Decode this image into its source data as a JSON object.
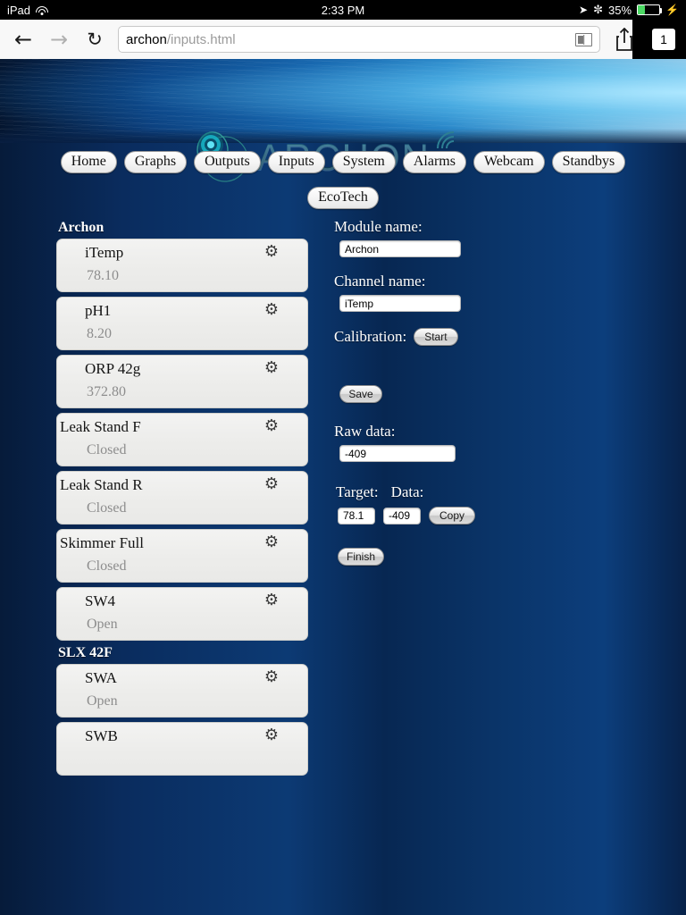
{
  "statusbar": {
    "carrier": "iPad",
    "wifi_icon": "wifi-icon",
    "time": "2:33 PM",
    "location_icon": "location-arrow-icon",
    "bluetooth_icon": "bluetooth-icon",
    "battery_percent": "35%",
    "battery_level": 35,
    "charging_icon": "lightning-bolt-icon"
  },
  "browser": {
    "back_icon": "back-arrow-icon",
    "forward_icon": "forward-arrow-icon",
    "reload_icon": "reload-icon",
    "url_host": "archon",
    "url_path": "/inputs.html",
    "url_full": "archon/inputs.html",
    "reader_icon": "reader-view-icon",
    "share_icon": "share-icon",
    "bookmark_icon": "star-icon",
    "tab_count": "1"
  },
  "header": {
    "logo_text": "ARCHON",
    "logo_mark_icon": "archon-circle-logo-icon",
    "logo_wifi_icon": "wifi-signal-icon"
  },
  "nav": {
    "row1": [
      {
        "label": "Home"
      },
      {
        "label": "Graphs"
      },
      {
        "label": "Outputs"
      },
      {
        "label": "Inputs"
      },
      {
        "label": "System"
      },
      {
        "label": "Alarms"
      },
      {
        "label": "Webcam"
      },
      {
        "label": "Standbys"
      }
    ],
    "row2": [
      {
        "label": "EcoTech"
      }
    ]
  },
  "channel_list": {
    "groups": [
      {
        "title": "Archon",
        "items": [
          {
            "name": "iTemp",
            "value": "78.10",
            "flush": false,
            "gear_icon": "gear-icon"
          },
          {
            "name": "pH1",
            "value": "8.20",
            "flush": false,
            "gear_icon": "gear-icon"
          },
          {
            "name": "ORP 42g",
            "value": "372.80",
            "flush": false,
            "gear_icon": "gear-icon"
          },
          {
            "name": "Leak Stand F",
            "value": "Closed",
            "flush": true,
            "gear_icon": "gear-icon"
          },
          {
            "name": "Leak Stand R",
            "value": "Closed",
            "flush": true,
            "gear_icon": "gear-icon"
          },
          {
            "name": "Skimmer Full",
            "value": "Closed",
            "flush": true,
            "gear_icon": "gear-icon"
          },
          {
            "name": "SW4",
            "value": "Open",
            "flush": false,
            "gear_icon": "gear-icon"
          }
        ]
      },
      {
        "title": "SLX 42F",
        "items": [
          {
            "name": "SWA",
            "value": "Open",
            "flush": false,
            "gear_icon": "gear-icon"
          },
          {
            "name": "SWB",
            "value": "",
            "flush": false,
            "gear_icon": "gear-icon"
          }
        ]
      }
    ]
  },
  "form": {
    "module_label": "Module name:",
    "module_value": "Archon",
    "channel_label": "Channel name:",
    "channel_value": "iTemp",
    "calibration_label": "Calibration:",
    "start_label": "Start",
    "save_label": "Save",
    "raw_data_label": "Raw data:",
    "raw_data_value": "-409",
    "target_label": "Target:",
    "target_value": "78.1",
    "data_label": "Data:",
    "data_value": "-409",
    "copy_label": "Copy",
    "finish_label": "Finish"
  },
  "colors": {
    "accent_blue": "#0c3a74",
    "banner_cyan": "#7fc9e8",
    "logo_teal": "#1a4a63",
    "card_bg": "#eeeeec",
    "battery_green": "#4cd964"
  }
}
